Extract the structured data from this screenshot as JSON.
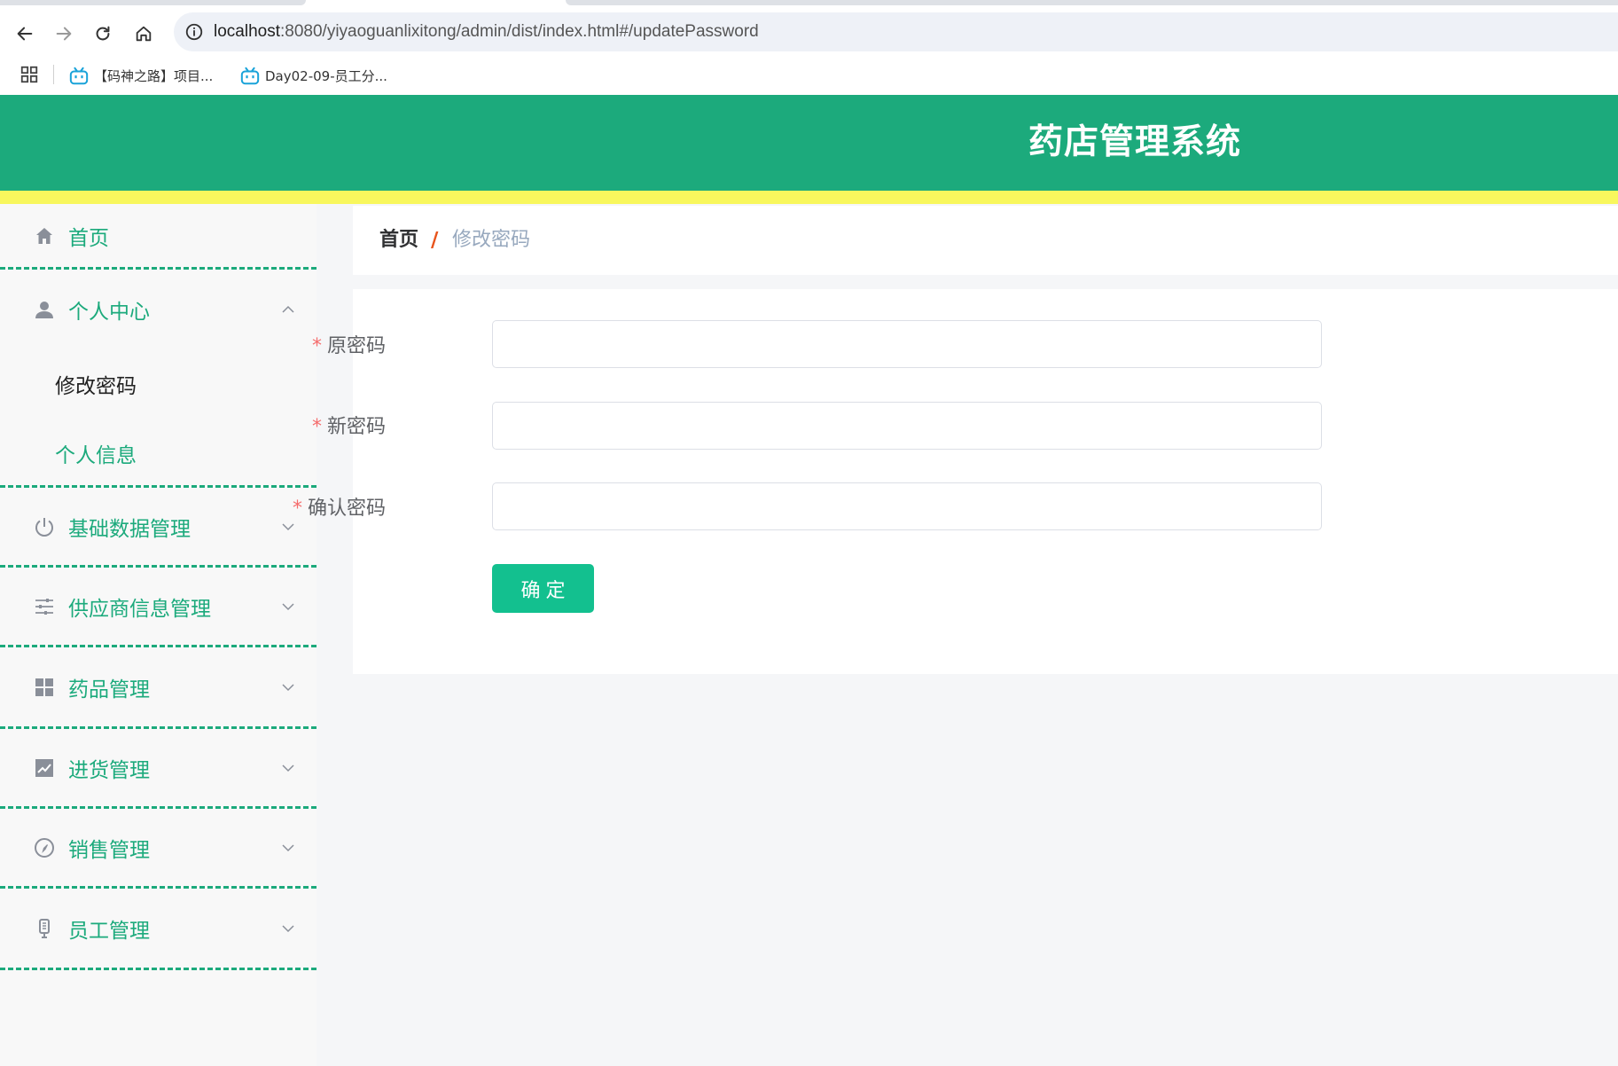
{
  "browser": {
    "url_host": "localhost",
    "url_path": ":8080/yiyaoguanlixitong/admin/dist/index.html#/updatePassword",
    "bookmarks": [
      {
        "label": "【码神之路】项目..."
      },
      {
        "label": "Day02-09-员工分..."
      }
    ]
  },
  "app": {
    "title": "药店管理系统",
    "colors": {
      "header": "#1caa7c",
      "accent_strip": "#f8f75d",
      "menu_text": "#1caa7c",
      "button": "#13c08f",
      "required_star": "#f56c6c"
    }
  },
  "sidebar": {
    "items": [
      {
        "label": "首页",
        "icon": "home-icon"
      },
      {
        "label": "个人中心",
        "icon": "user-icon",
        "expanded": true,
        "children": [
          {
            "label": "修改密码",
            "active": true
          },
          {
            "label": "个人信息",
            "active": false
          }
        ]
      },
      {
        "label": "基础数据管理",
        "icon": "power-icon"
      },
      {
        "label": "供应商信息管理",
        "icon": "sliders-icon"
      },
      {
        "label": "药品管理",
        "icon": "grid-icon"
      },
      {
        "label": "进货管理",
        "icon": "chart-icon"
      },
      {
        "label": "销售管理",
        "icon": "compass-icon"
      },
      {
        "label": "员工管理",
        "icon": "microphone-icon"
      }
    ]
  },
  "breadcrumb": {
    "home": "首页",
    "separator": "/",
    "current": "修改密码"
  },
  "form": {
    "required_mark": "*",
    "fields": [
      {
        "label": "原密码",
        "value": ""
      },
      {
        "label": "新密码",
        "value": ""
      },
      {
        "label": "确认密码",
        "value": ""
      }
    ],
    "submit_label": "确定"
  }
}
